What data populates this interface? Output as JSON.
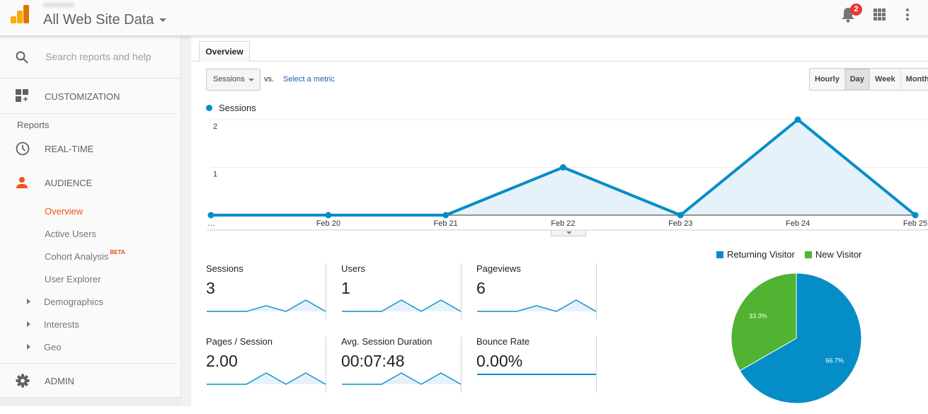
{
  "header": {
    "property_title": "All Web Site Data",
    "notifications_count": "2",
    "icons": [
      "analytics-logo-icon",
      "bell-icon",
      "apps-grid-icon",
      "more-vert-icon"
    ]
  },
  "sidebar": {
    "search_placeholder": "Search reports and help",
    "customization_label": "CUSTOMIZATION",
    "reports_label": "Reports",
    "realtime_label": "REAL-TIME",
    "audience_label": "AUDIENCE",
    "audience_items": [
      {
        "label": "Overview",
        "active": true
      },
      {
        "label": "Active Users"
      },
      {
        "label": "Cohort Analysis",
        "badge": "BETA"
      },
      {
        "label": "User Explorer"
      }
    ],
    "expandable_items": [
      "Demographics",
      "Interests",
      "Geo"
    ],
    "admin_label": "ADMIN"
  },
  "main": {
    "tab_label": "Overview",
    "metric_select": "Sessions",
    "vs_label": "vs.",
    "select_metric_link": "Select a metric",
    "granularity": [
      {
        "label": "Hourly"
      },
      {
        "label": "Day",
        "selected": true
      },
      {
        "label": "Week"
      },
      {
        "label": "Month"
      }
    ],
    "legend_label": "Sessions"
  },
  "colors": {
    "primary_series": "#058dc7",
    "area_fill": "#e5f2f9",
    "new_visitor": "#50b432",
    "accent_orange": "#f4511e"
  },
  "chart_data": [
    {
      "type": "area",
      "title": "",
      "series": [
        {
          "name": "Sessions",
          "values": [
            0,
            0,
            0,
            1,
            0,
            2,
            0
          ]
        }
      ],
      "x": [
        "…",
        "Feb 20",
        "Feb 21",
        "Feb 22",
        "Feb 23",
        "Feb 24",
        "Feb 25"
      ],
      "yticks": [
        "1",
        "2"
      ],
      "ylim": [
        0,
        2
      ],
      "grid": true,
      "legend": "top-left"
    },
    {
      "type": "pie",
      "labels": [
        "Returning Visitor",
        "New Visitor"
      ],
      "values": [
        66.7,
        33.3
      ],
      "value_labels": [
        "66.7%",
        "33.3%"
      ],
      "legend": "top"
    }
  ],
  "scorecards": [
    {
      "label": "Sessions",
      "value": "3",
      "spark": [
        0,
        0,
        0,
        1,
        0,
        2,
        0
      ]
    },
    {
      "label": "Users",
      "value": "1",
      "spark": [
        0,
        0,
        0,
        1,
        0,
        1,
        0
      ]
    },
    {
      "label": "Pageviews",
      "value": "6",
      "spark": [
        0,
        0,
        0,
        1,
        0,
        2,
        0
      ]
    },
    {
      "label": "Pages / Session",
      "value": "2.00",
      "spark": [
        0,
        0,
        0,
        1,
        0,
        1,
        0
      ]
    },
    {
      "label": "Avg. Session Duration",
      "value": "00:07:48",
      "spark": [
        0,
        0,
        0,
        1,
        0,
        1,
        0
      ]
    },
    {
      "label": "Bounce Rate",
      "value": "0.00%",
      "spark": [
        0,
        0,
        0,
        0,
        0,
        0,
        0
      ]
    }
  ]
}
